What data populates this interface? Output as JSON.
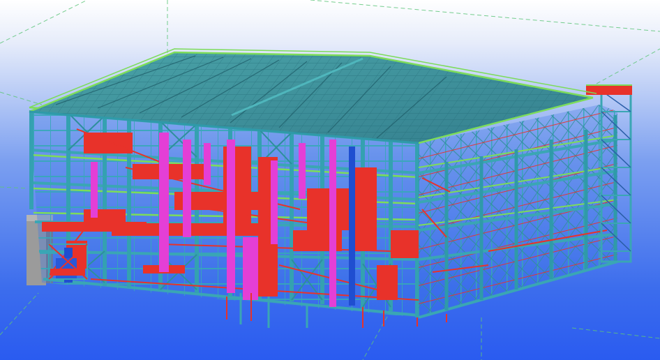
{
  "viewport": {
    "type": "3d-structural-model-view",
    "background_gradient": [
      "#ffffff",
      "#b6c9f2",
      "#3f6fe8",
      "#2a5df0"
    ]
  },
  "colors": {
    "steel_columns_beams": "#3aa6b4",
    "steel_columns_dark": "#2c8e9c",
    "roof_deck": "#3a9a9f",
    "roof_purlins": "#2f7f8a",
    "handrail_green": "#7ddc5a",
    "equipment_red": "#e8322a",
    "equipment_magenta": "#e43fd6",
    "column_blue": "#1f4ed0",
    "concrete_gray": "#9a9a9a",
    "grid_line_green": "#5ec67a"
  },
  "icons": [
    "building-model-icon"
  ]
}
